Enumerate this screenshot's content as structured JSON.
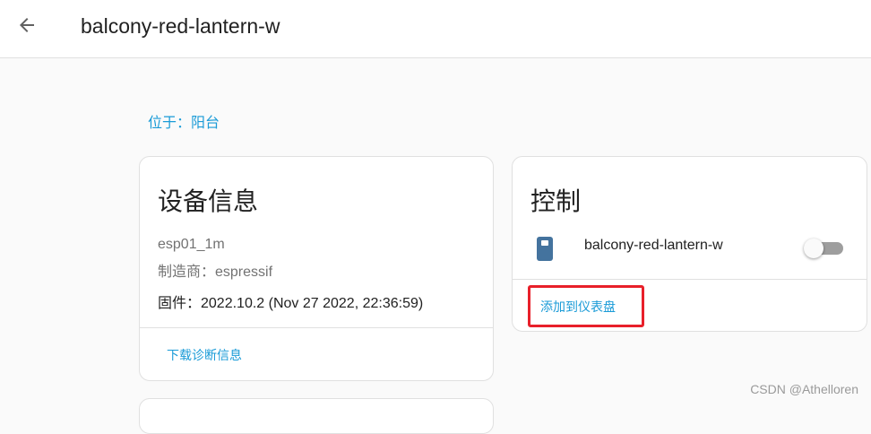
{
  "header": {
    "back_icon": "arrow-left-icon",
    "title": "balcony-red-lantern-w"
  },
  "area": {
    "label": "位于：阳台"
  },
  "device_info_card": {
    "title": "设备信息",
    "model": "esp01_1m",
    "manufacturer": "制造商：espressif",
    "firmware": "固件：2022.10.2 (Nov 27 2022, 22:36:59)",
    "download_diagnostics": "下载诊断信息"
  },
  "controls_card": {
    "title": "控制",
    "entity_icon": "switch-device-icon",
    "entity_name": "balcony-red-lantern-w",
    "toggle_state": "off",
    "add_to_dashboard": "添加到仪表盘"
  },
  "colors": {
    "accent": "#1a9bd7",
    "highlight": "#e8202a",
    "icon_blue": "#44739e"
  },
  "watermark": "CSDN @Athelloren"
}
